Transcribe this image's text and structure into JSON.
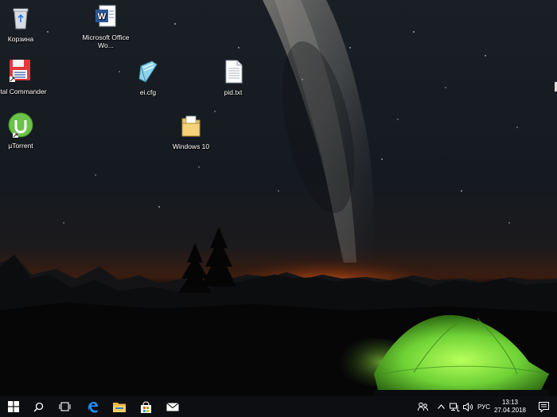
{
  "desktop": {
    "icons": [
      {
        "label": "Корзина",
        "icon": "recycle-bin-icon"
      },
      {
        "label": "Microsoft Office Wo...",
        "icon": "word-document-icon"
      },
      {
        "label": "Total Commander",
        "icon": "total-commander-icon"
      },
      {
        "label": "ei.cfg",
        "icon": "cfg-file-icon"
      },
      {
        "label": "pid.txt",
        "icon": "text-file-icon"
      },
      {
        "label": "µTorrent",
        "icon": "utorrent-icon"
      },
      {
        "label": "Windows 10",
        "icon": "folder-icon"
      }
    ]
  },
  "taskbar": {
    "pinned": [
      "start-icon",
      "search-icon",
      "task-view-icon",
      "edge-icon",
      "file-explorer-icon",
      "store-icon",
      "mail-icon"
    ],
    "tray": {
      "language": "РУС",
      "time": "13:13",
      "date": "27.04.2018"
    }
  },
  "colors": {
    "taskbar_bg": "#0c0e12",
    "tent_green": "#6fd236",
    "horizon_orange": "#e0601a"
  }
}
